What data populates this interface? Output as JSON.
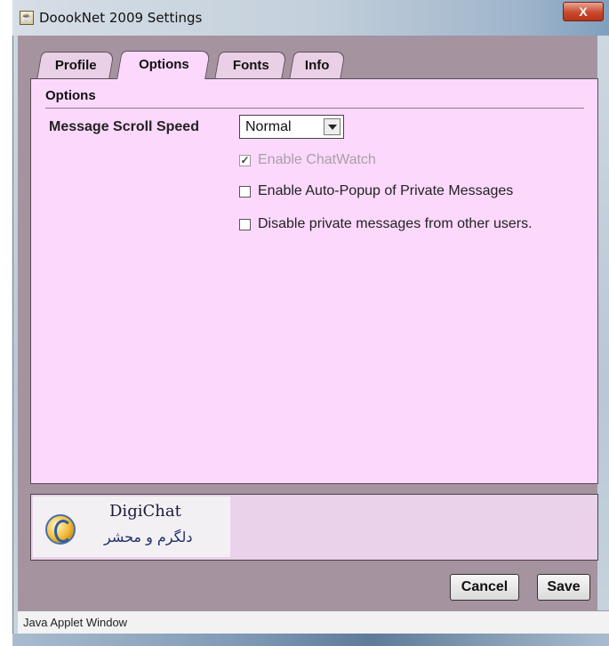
{
  "window": {
    "title": "DoookNet 2009 Settings",
    "close_glyph": "X"
  },
  "tabs": [
    {
      "label": "Profile",
      "active": false
    },
    {
      "label": "Options",
      "active": true
    },
    {
      "label": "Fonts",
      "active": false
    },
    {
      "label": "Info",
      "active": false
    }
  ],
  "options": {
    "section_title": "Options",
    "scroll_speed_label": "Message Scroll Speed",
    "scroll_speed_value": "Normal",
    "checkboxes": [
      {
        "label": "Enable ChatWatch",
        "checked": true,
        "disabled": true
      },
      {
        "label": "Enable Auto-Popup of Private Messages",
        "checked": false,
        "disabled": false
      },
      {
        "label": "Disable private messages from other users.",
        "checked": false,
        "disabled": false
      }
    ]
  },
  "logo": {
    "title": "DigiChat",
    "subtitle": "دلگرم و محشر"
  },
  "buttons": {
    "cancel": "Cancel",
    "save": "Save"
  },
  "status": {
    "text": "Java Applet Window"
  },
  "colors": {
    "panel_bg": "#fcd8fc",
    "frame_bg": "#a593a0"
  },
  "icons": {
    "window_icon": "java-applet-icon",
    "logo_icon": "digichat-logo-icon",
    "dropdown_icon": "chevron-down-icon"
  }
}
